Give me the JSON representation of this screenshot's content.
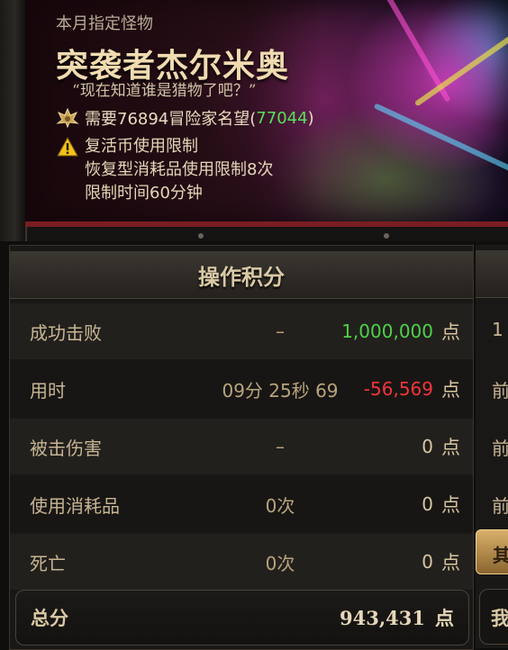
{
  "monster": {
    "subtitle": "本月指定怪物",
    "name": "突袭者杰尔米奥",
    "quote": "“现在知道谁是猎物了吧？”",
    "requirement_prefix": "需要76894冒险家名望(",
    "requirement_current": "77044",
    "requirement_suffix": ")",
    "restriction_title": "复活币使用限制",
    "restriction_line1": "恢复型消耗品使用限制8次",
    "restriction_line2": "限制时间60分钟"
  },
  "score": {
    "title": "操作积分",
    "rows": [
      {
        "label": "成功击败",
        "detail": "–",
        "value": "1,000,000",
        "unit": "点",
        "color": "#4fd14a"
      },
      {
        "label": "用时",
        "detail": "09分 25秒 69",
        "value": "-56,569",
        "unit": "点",
        "color": "#f2353b"
      },
      {
        "label": "被击伤害",
        "detail": "–",
        "value": "0",
        "unit": "点",
        "color": "#d8c6a0"
      },
      {
        "label": "使用消耗品",
        "detail": "0次",
        "value": "0",
        "unit": "点",
        "color": "#d8c6a0"
      },
      {
        "label": "死亡",
        "detail": "0次",
        "value": "0",
        "unit": "点",
        "color": "#d8c6a0"
      }
    ],
    "total_label": "总分",
    "total_value": "943,431",
    "total_unit": "点"
  },
  "right_column": {
    "cells": [
      "1",
      "前",
      "前",
      "前"
    ],
    "button_label": "其",
    "total_label": "我"
  }
}
